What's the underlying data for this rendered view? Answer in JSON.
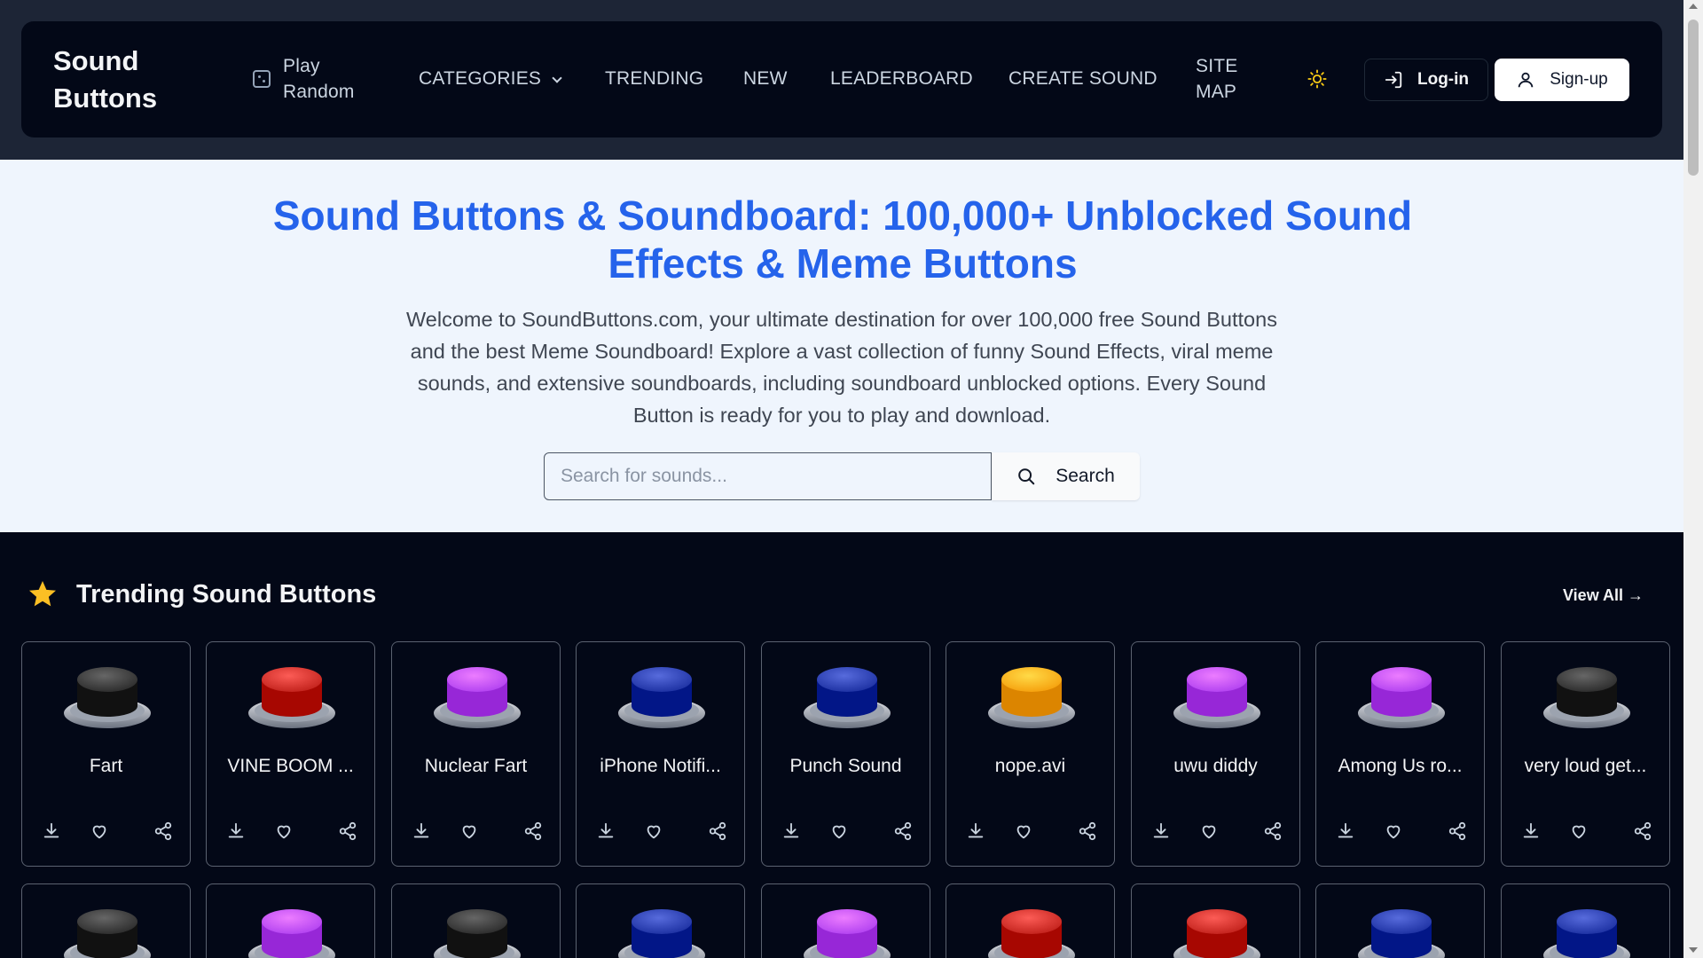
{
  "brand": "Sound Buttons",
  "nav": {
    "play_random": "Play Random",
    "categories": "CATEGORIES",
    "trending": "TRENDING",
    "new": "NEW",
    "leaderboard": "LEADERBOARD",
    "create_sound": "CREATE SOUND",
    "site_map": "SITE MAP",
    "login": "Log-in",
    "signup": "Sign-up"
  },
  "hero": {
    "title": "Sound Buttons & Soundboard: 100,000+ Unblocked Sound Effects & Meme Buttons",
    "description": "Welcome to SoundButtons.com, your ultimate destination for over 100,000 free Sound Buttons and the best Meme Soundboard! Explore a vast collection of funny Sound Effects, viral meme sounds, and extensive soundboards, including soundboard unblocked options. Every Sound Button is ready for you to play and download.",
    "search_placeholder": "Search for sounds...",
    "search_button": "Search"
  },
  "trending": {
    "title": "Trending Sound Buttons",
    "view_all": "View All →",
    "row1": [
      {
        "label": "Fart",
        "color": "#2a2a2a"
      },
      {
        "label": "VINE BOOM ...",
        "color": "#c0201a"
      },
      {
        "label": "Nuclear Fart",
        "color": "#b040f0"
      },
      {
        "label": "iPhone Notifi...",
        "color": "#1b2fa0"
      },
      {
        "label": "Punch Sound",
        "color": "#1b2fa0"
      },
      {
        "label": "nope.avi",
        "color": "#f59e0b"
      },
      {
        "label": "uwu diddy",
        "color": "#b040f0"
      },
      {
        "label": "Among Us ro...",
        "color": "#b040f0"
      },
      {
        "label": "very loud get...",
        "color": "#2a2a2a"
      }
    ],
    "row2": [
      {
        "color": "#2a2a2a"
      },
      {
        "color": "#b040f0"
      },
      {
        "color": "#2a2a2a"
      },
      {
        "color": "#1b2fa0"
      },
      {
        "color": "#b040f0"
      },
      {
        "color": "#c0201a"
      },
      {
        "color": "#c0201a"
      },
      {
        "color": "#1b2fa0"
      },
      {
        "color": "#1b2fa0"
      }
    ]
  }
}
